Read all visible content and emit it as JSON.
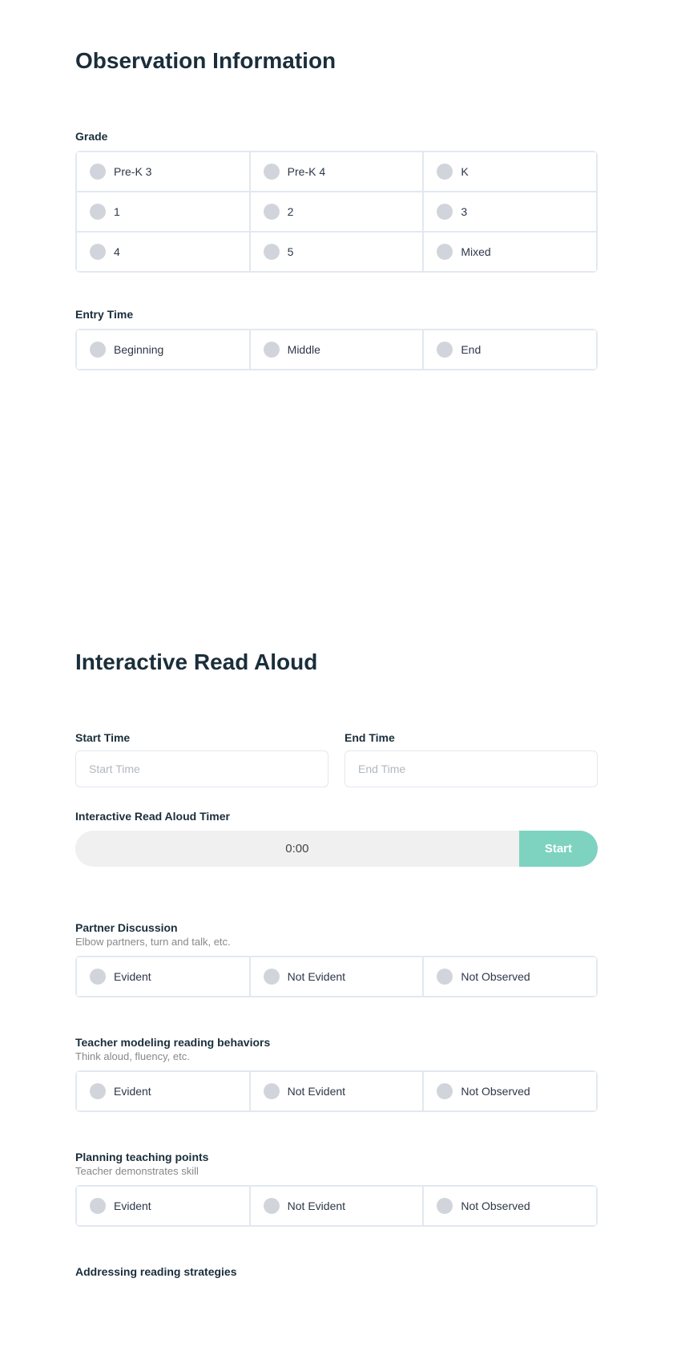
{
  "observation": {
    "title": "Observation Information",
    "grade_label": "Grade",
    "grade_options": [
      {
        "label": "Pre-K 3"
      },
      {
        "label": "Pre-K 4"
      },
      {
        "label": "K"
      },
      {
        "label": "1"
      },
      {
        "label": "2"
      },
      {
        "label": "3"
      },
      {
        "label": "4"
      },
      {
        "label": "5"
      },
      {
        "label": "Mixed"
      }
    ],
    "entry_time_label": "Entry Time",
    "entry_time_options": [
      {
        "label": "Beginning"
      },
      {
        "label": "Middle"
      },
      {
        "label": "End"
      }
    ]
  },
  "ira": {
    "title": "Interactive Read Aloud",
    "start_time_label": "Start Time",
    "start_time_placeholder": "Start Time",
    "end_time_label": "End Time",
    "end_time_placeholder": "End Time",
    "timer_label": "Interactive Read Aloud Timer",
    "timer_value": "0:00",
    "start_button": "Start",
    "partner_discussion_label": "Partner Discussion",
    "partner_discussion_sub": "Elbow partners, turn and talk, etc.",
    "partner_options": [
      {
        "label": "Evident"
      },
      {
        "label": "Not Evident"
      },
      {
        "label": "Not Observed"
      }
    ],
    "teacher_modeling_label": "Teacher modeling reading behaviors",
    "teacher_modeling_sub": "Think aloud, fluency, etc.",
    "teacher_options": [
      {
        "label": "Evident"
      },
      {
        "label": "Not Evident"
      },
      {
        "label": "Not Observed"
      }
    ],
    "planning_label": "Planning teaching points",
    "planning_sub": "Teacher demonstrates skill",
    "planning_options": [
      {
        "label": "Evident"
      },
      {
        "label": "Not Evident"
      },
      {
        "label": "Not Observed"
      }
    ],
    "addressing_label": "Addressing reading strategies"
  }
}
